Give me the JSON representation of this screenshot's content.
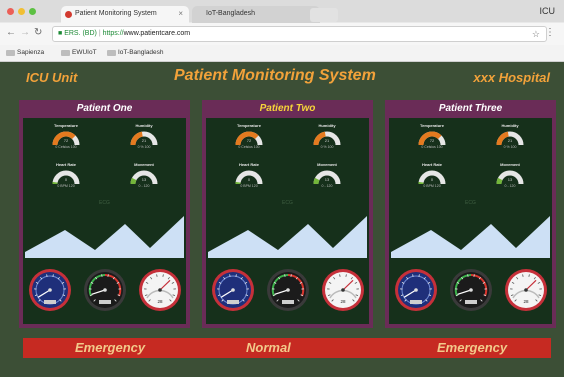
{
  "browser": {
    "tabs": [
      {
        "label": "Patient Monitoring System",
        "active": true
      },
      {
        "label": "IoT-Bangladesh",
        "active": false
      }
    ],
    "corner_label": "ICU",
    "back_icon": "arrow-left-icon",
    "forward_icon": "arrow-right-icon",
    "reload_icon": "reload-icon",
    "address": {
      "secure_label": "ERS. (BD)",
      "separator": "|",
      "protocol": "https://",
      "host": "www.patientcare.com"
    },
    "bookmarks": [
      "Sapienza",
      "EWUIoT",
      "IoT-Bangladesh"
    ]
  },
  "app": {
    "left_title": "ICU Unit",
    "center_title": "Patient Monitoring System",
    "right_title": "xxx Hospital",
    "colors": {
      "background": "#3c4f36",
      "header_text": "#f2a23a",
      "panel": "#6a2c57",
      "panel_inner": "#16301b",
      "status_bar": "#c62a22",
      "gauge_orange": "#e47a1f",
      "gauge_green": "#73b63a",
      "waveform": "#cde0f5"
    },
    "gauge_labels": {
      "temperature": "Temperature",
      "humidity": "Humidity",
      "heart_rate": "Heart Rate",
      "movement": "Movement"
    },
    "gauge_scales": {
      "temperature": "0  Celsius  100",
      "humidity": "0   %   100",
      "heart_rate": "0  BPM  120",
      "movement": "0    -    120"
    },
    "ecg_label": "ECG",
    "patients": [
      {
        "name": "Patient One",
        "highlighted": false,
        "temperature": "72",
        "humidity": "21",
        "heart_rate": "0",
        "movement": "13",
        "readout_level": 0.67,
        "readout_value": "28"
      },
      {
        "name": "Patient Two",
        "highlighted": true,
        "temperature": "72",
        "humidity": "21",
        "heart_rate": "0",
        "movement": "13",
        "readout_level": 0.67,
        "readout_value": "28"
      },
      {
        "name": "Patient Three",
        "highlighted": false,
        "temperature": "72",
        "humidity": "21",
        "heart_rate": "0",
        "movement": "13",
        "readout_level": 0.67,
        "readout_value": "28"
      }
    ],
    "status": [
      "Emergency",
      "Normal",
      "Emergency"
    ]
  }
}
